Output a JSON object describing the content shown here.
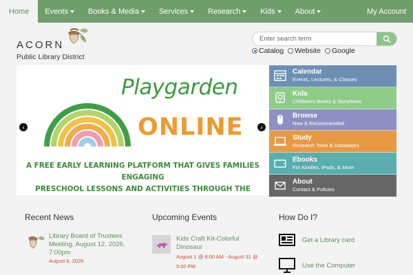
{
  "nav": {
    "items": [
      {
        "label": "Home",
        "active": true
      },
      {
        "label": "Events",
        "dropdown": true
      },
      {
        "label": "Books & Media",
        "dropdown": true
      },
      {
        "label": "Services",
        "dropdown": true
      },
      {
        "label": "Research",
        "dropdown": true
      },
      {
        "label": "Kids",
        "dropdown": true
      },
      {
        "label": "About",
        "dropdown": true
      }
    ],
    "account": "My Account"
  },
  "logo": {
    "name": "ACORN",
    "subtitle": "Public Library District",
    "icon": "acorn-icon"
  },
  "search": {
    "placeholder": "Enter search term",
    "value": "",
    "options": [
      "Catalog",
      "Website",
      "Google"
    ],
    "selected": "Catalog"
  },
  "hero": {
    "title_line1": "Playgarden",
    "title_line2": "ONLINE",
    "description_line1": "A FREE EARLY LEARNING PLATFORM THAT GIVES FAMILIES ENGAGING",
    "description_line2": "PRESCHOOL LESSONS AND ACTIVITIES THROUGH THE LIBRARY",
    "prev": "‹",
    "next": "›"
  },
  "side_menu": [
    {
      "label": "Calendar",
      "sub": "Events, Lectures, & Classes",
      "color": "#6d8fb4",
      "icon": "calendar-icon"
    },
    {
      "label": "Kids",
      "sub": "Children's Books & Storytimes",
      "color": "#8ecb86",
      "icon": "kids-book-icon"
    },
    {
      "label": "Browse",
      "sub": "New & Recommended",
      "color": "#8f8fc4",
      "icon": "mouse-icon"
    },
    {
      "label": "Study",
      "sub": "Research Tools & Databases",
      "color": "#e79a42",
      "icon": "laptop-icon"
    },
    {
      "label": "Ebooks",
      "sub": "For Kindles, iPads, & More",
      "color": "#5aaeae",
      "icon": "tablet-icon"
    },
    {
      "label": "About",
      "sub": "Contact & Policies",
      "color": "#666666",
      "icon": "mail-icon"
    }
  ],
  "news": {
    "title": "Recent News",
    "item_title": "Library Board of Trustees Meeting, August 12, 2026, 7:00pm",
    "item_date": "August 6, 2026"
  },
  "events": {
    "title": "Upcoming Events",
    "item_title": "Kids Craft Kit-Colorful Dinosaur",
    "item_date": "August 1 @ 8:00 AM - August 31 @ 5:00 PM"
  },
  "howdo": {
    "title": "How Do I?",
    "items": [
      {
        "label": "Get a Library card",
        "icon": "library-card-icon"
      },
      {
        "label": "Use the Computer",
        "icon": "computer-icon"
      }
    ]
  },
  "colors": {
    "nav": "#6f9e6b",
    "link": "#5e8f5b",
    "date": "#c44a3a",
    "search_button": "#8cc48a"
  }
}
